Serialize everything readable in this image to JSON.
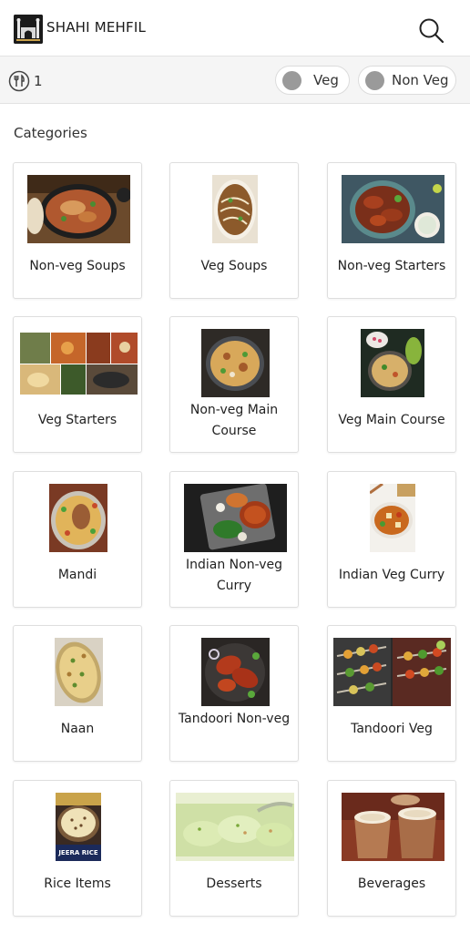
{
  "app": {
    "brand": "SHAHI MEHFIL"
  },
  "filter_bar": {
    "table_count": "1",
    "chips": {
      "veg": "Veg",
      "non_veg": "Non Veg"
    }
  },
  "section": {
    "title": "Categories"
  },
  "categories": [
    {
      "label": "Non-veg Soups"
    },
    {
      "label": "Veg Soups"
    },
    {
      "label": "Non-veg Starters"
    },
    {
      "label": "Veg Starters"
    },
    {
      "label": "Non-veg Main Course"
    },
    {
      "label": "Veg Main Course"
    },
    {
      "label": "Mandi"
    },
    {
      "label": "Indian Non-veg Curry"
    },
    {
      "label": "Indian Veg Curry"
    },
    {
      "label": "Naan"
    },
    {
      "label": "Tandoori Non-veg"
    },
    {
      "label": "Tandoori Veg"
    },
    {
      "label": "Rice Items",
      "image_caption": "JEERA RICE"
    },
    {
      "label": "Desserts"
    },
    {
      "label": "Beverages"
    }
  ],
  "icons": {
    "logo": "charminar-logo",
    "search": "search-icon",
    "table": "cutlery-icon"
  },
  "colors": {
    "chip_dot": "#9a9a9a",
    "header_bg": "#ffffff",
    "filter_bg": "#f5f5f5"
  }
}
